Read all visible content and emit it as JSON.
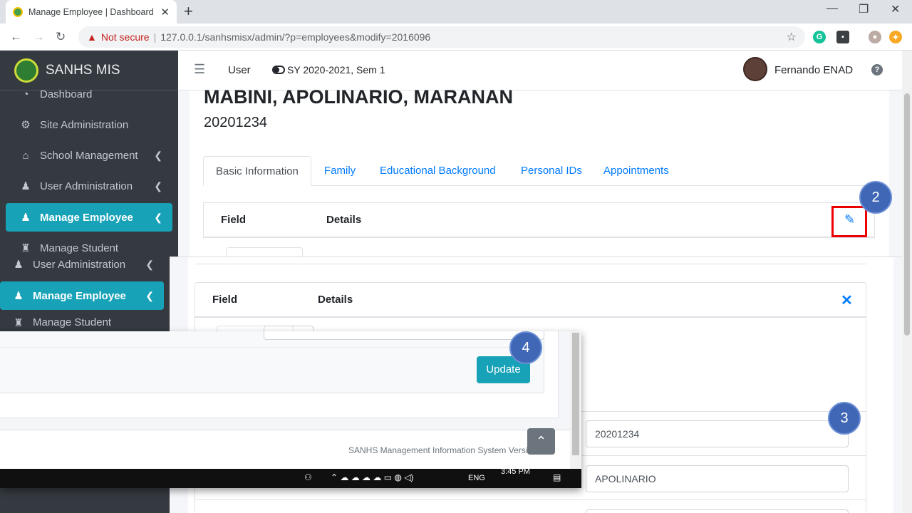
{
  "browser": {
    "tab_title": "Manage Employee | Dashboard |",
    "address_security": "Not secure",
    "url": "127.0.0.1/sanhsmisx/admin/?p=employees&modify=2016096"
  },
  "sidebar": {
    "brand": "SANHS MIS",
    "items": [
      {
        "label": "Dashboard"
      },
      {
        "label": "Site Administration"
      },
      {
        "label": "School Management"
      },
      {
        "label": "User Administration"
      },
      {
        "label": "Manage Employee"
      },
      {
        "label": "Manage Student"
      }
    ],
    "overlay_items": [
      {
        "label": "User Administration"
      },
      {
        "label": "Manage Employee"
      },
      {
        "label": "Manage Student"
      }
    ]
  },
  "header": {
    "user_label": "User",
    "school_year": "SY 2020-2021, Sem 1",
    "user_name": "Fernando ENAD"
  },
  "employee": {
    "name": "MABINI, APOLINARIO, MARANAN",
    "id": "20201234"
  },
  "tabs": [
    {
      "label": "Basic Information"
    },
    {
      "label": "Family"
    },
    {
      "label": "Educational Background"
    },
    {
      "label": "Personal IDs"
    },
    {
      "label": "Appointments"
    }
  ],
  "table": {
    "field_header": "Field",
    "details_header": "Details"
  },
  "form": {
    "employee_id_value": "20201234",
    "first_name_value": "APOLINARIO",
    "update_label": "Update"
  },
  "footer": {
    "text": "SANHS Management Information System Versio"
  },
  "taskbar": {
    "time": "3:45 PM",
    "lang": "ENG"
  },
  "steps": {
    "two": "2",
    "three": "3",
    "four": "4"
  },
  "colors": {
    "accent": "#17a2b8",
    "link": "#007bff",
    "sidebar": "#343a40",
    "badge": "#3f67b5",
    "highlight": "#ee0000"
  }
}
